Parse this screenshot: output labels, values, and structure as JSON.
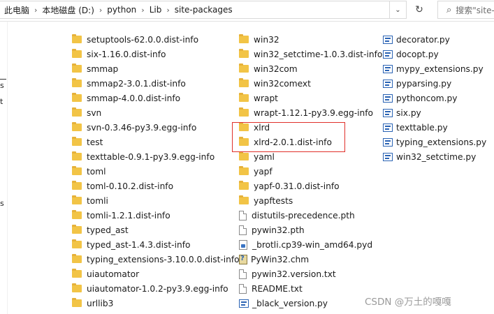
{
  "address_bar": {
    "crumbs": [
      "此电脑",
      "本地磁盘 (D:)",
      "python",
      "Lib",
      "site-packages"
    ],
    "separator": "›",
    "dropdown_glyph": "⌄",
    "refresh_glyph": "↻",
    "search_placeholder": "搜索\"site-packages\"",
    "search_icon": "⌕"
  },
  "nav_fragments": [
    "s",
    "t",
    "s"
  ],
  "columns": [
    {
      "items": [
        {
          "name": "setuptools-62.0.0.dist-info",
          "type": "folder"
        },
        {
          "name": "six-1.16.0.dist-info",
          "type": "folder"
        },
        {
          "name": "smmap",
          "type": "folder"
        },
        {
          "name": "smmap2-3.0.1.dist-info",
          "type": "folder"
        },
        {
          "name": "smmap-4.0.0.dist-info",
          "type": "folder"
        },
        {
          "name": "svn",
          "type": "folder"
        },
        {
          "name": "svn-0.3.46-py3.9.egg-info",
          "type": "folder"
        },
        {
          "name": "test",
          "type": "folder"
        },
        {
          "name": "texttable-0.9.1-py3.9.egg-info",
          "type": "folder"
        },
        {
          "name": "toml",
          "type": "folder"
        },
        {
          "name": "toml-0.10.2.dist-info",
          "type": "folder"
        },
        {
          "name": "tomli",
          "type": "folder"
        },
        {
          "name": "tomli-1.2.1.dist-info",
          "type": "folder"
        },
        {
          "name": "typed_ast",
          "type": "folder"
        },
        {
          "name": "typed_ast-1.4.3.dist-info",
          "type": "folder"
        },
        {
          "name": "typing_extensions-3.10.0.0.dist-info",
          "type": "folder"
        },
        {
          "name": "uiautomator",
          "type": "folder"
        },
        {
          "name": "uiautomator-1.0.2-py3.9.egg-info",
          "type": "folder"
        },
        {
          "name": "urllib3",
          "type": "folder"
        }
      ]
    },
    {
      "items": [
        {
          "name": "win32",
          "type": "folder"
        },
        {
          "name": "win32_setctime-1.0.3.dist-info",
          "type": "folder"
        },
        {
          "name": "win32com",
          "type": "folder"
        },
        {
          "name": "win32comext",
          "type": "folder"
        },
        {
          "name": "wrapt",
          "type": "folder"
        },
        {
          "name": "wrapt-1.12.1-py3.9.egg-info",
          "type": "folder"
        },
        {
          "name": "xlrd",
          "type": "folder"
        },
        {
          "name": "xlrd-2.0.1.dist-info",
          "type": "folder"
        },
        {
          "name": "yaml",
          "type": "folder"
        },
        {
          "name": "yapf",
          "type": "folder"
        },
        {
          "name": "yapf-0.31.0.dist-info",
          "type": "folder"
        },
        {
          "name": "yapftests",
          "type": "folder"
        },
        {
          "name": "distutils-precedence.pth",
          "type": "file"
        },
        {
          "name": "pywin32.pth",
          "type": "file"
        },
        {
          "name": "_brotli.cp39-win_amd64.pyd",
          "type": "pyd"
        },
        {
          "name": "PyWin32.chm",
          "type": "chm"
        },
        {
          "name": "pywin32.version.txt",
          "type": "txt"
        },
        {
          "name": "README.txt",
          "type": "txt"
        },
        {
          "name": "_black_version.py",
          "type": "py"
        }
      ]
    },
    {
      "items": [
        {
          "name": "decorator.py",
          "type": "py"
        },
        {
          "name": "docopt.py",
          "type": "py"
        },
        {
          "name": "mypy_extensions.py",
          "type": "py"
        },
        {
          "name": "pyparsing.py",
          "type": "py"
        },
        {
          "name": "pythoncom.py",
          "type": "py"
        },
        {
          "name": "six.py",
          "type": "py"
        },
        {
          "name": "texttable.py",
          "type": "py"
        },
        {
          "name": "typing_extensions.py",
          "type": "py"
        },
        {
          "name": "win32_setctime.py",
          "type": "py"
        }
      ]
    }
  ],
  "highlight_color": "#e0302a",
  "watermark": "CSDN @万土的嘎嘎"
}
